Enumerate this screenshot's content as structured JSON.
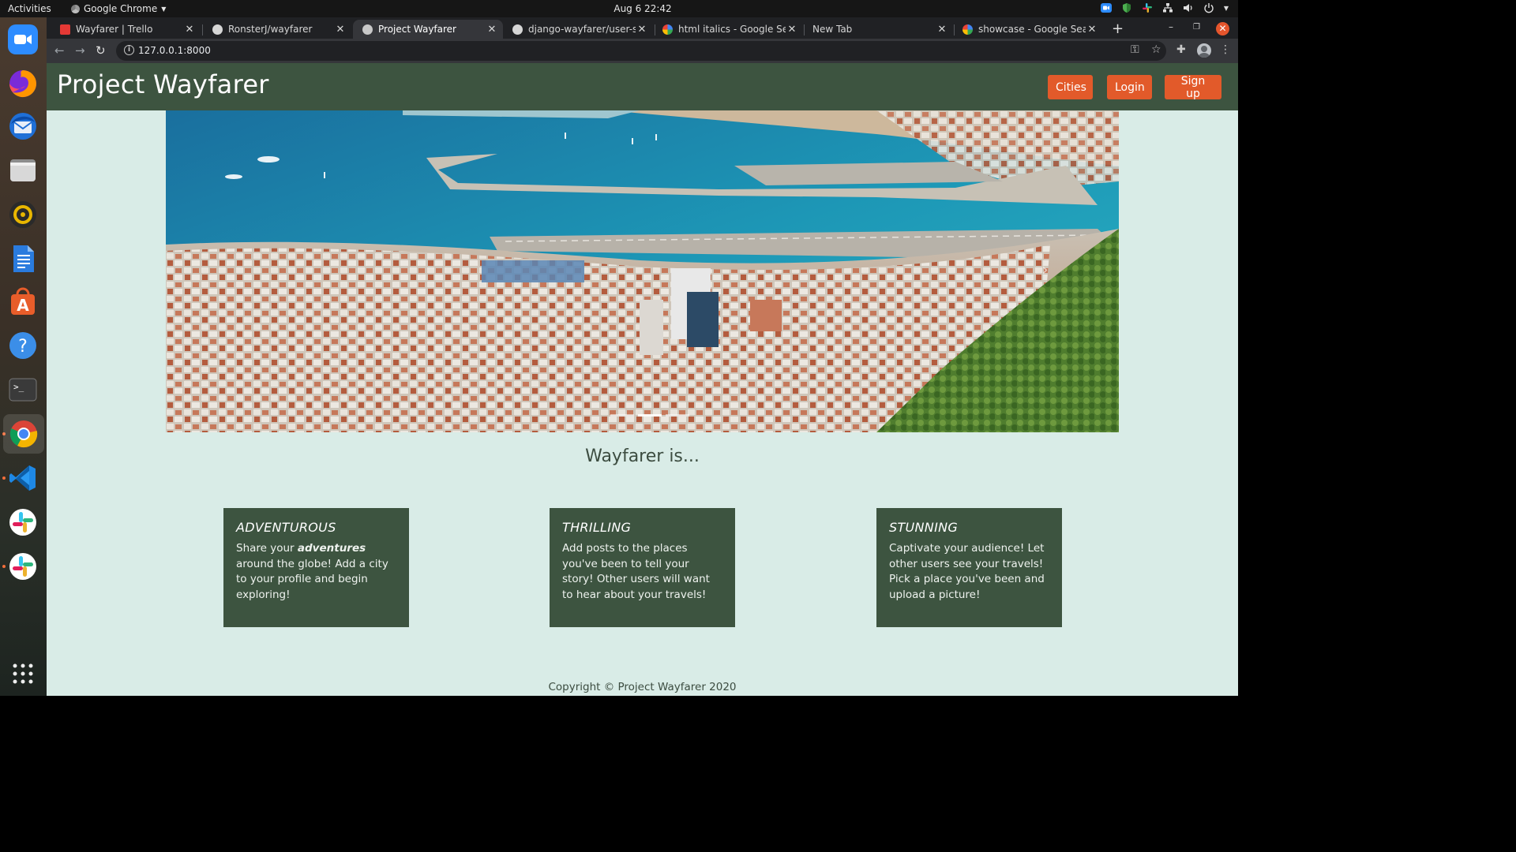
{
  "os": {
    "activities": "Activities",
    "app_name": "Google Chrome",
    "clock": "Aug 6  22:42"
  },
  "dock": {
    "items": [
      "zoom-icon",
      "firefox-icon",
      "thunderbird-icon",
      "files-icon",
      "rhythmbox-icon",
      "libreoffice-writer-icon",
      "software-center-icon",
      "help-icon",
      "terminal-icon",
      "chrome-icon",
      "vscode-icon",
      "slack-icon",
      "slack-icon",
      "show-apps-icon"
    ]
  },
  "browser": {
    "tabs": [
      {
        "title": "Wayfarer | Trello"
      },
      {
        "title": "RonsterJ/wayfarer"
      },
      {
        "title": "Project Wayfarer"
      },
      {
        "title": "django-wayfarer/user-st"
      },
      {
        "title": "html italics - Google Sear"
      },
      {
        "title": "New Tab"
      },
      {
        "title": "showcase - Google Search"
      }
    ],
    "url": "127.0.0.1:8000"
  },
  "site": {
    "brand": "Project Wayfarer",
    "nav": {
      "cities": "Cities",
      "login": "Login",
      "signup": "Sign up"
    },
    "intro": "Wayfarer is...",
    "cards": [
      {
        "title": "ADVENTUROUS",
        "text_before": "Share your ",
        "bold": "adventures",
        "text_after": " around the globe! Add a city to your profile and begin exploring!"
      },
      {
        "title": "THRILLING",
        "text": "Add posts to the places you've been to tell your story! Other users will want to hear about your travels!"
      },
      {
        "title": "STUNNING",
        "text": "Captivate your audience! Let other users see your travels! Pick a place you've been and upload a picture!"
      }
    ],
    "footer": "Copyright © Project Wayfarer 2020"
  },
  "colors": {
    "nav_green": "#3d5440",
    "accent_orange": "#e25a2a",
    "page_bg": "#d9ece7"
  }
}
